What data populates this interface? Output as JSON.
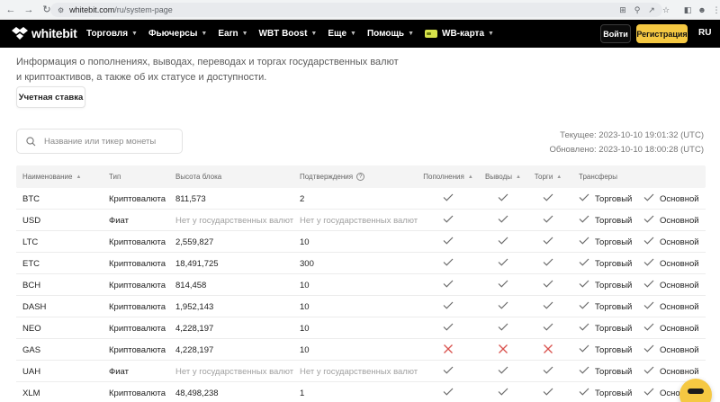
{
  "browser": {
    "url_host": "whitebit.com",
    "url_path": "/ru/system-page"
  },
  "header": {
    "logo_text": "whitebit",
    "nav": [
      {
        "label": "Торговля"
      },
      {
        "label": "Фьючерсы"
      },
      {
        "label": "Earn"
      },
      {
        "label": "WBT Boost"
      },
      {
        "label": "Еще"
      },
      {
        "label": "Помощь"
      },
      {
        "label": "WB-карта"
      }
    ],
    "login_label": "Войти",
    "register_label": "Регистрация",
    "lang_label": "RU"
  },
  "intro": {
    "text_line1": "Информация о пополнениях, выводах, переводах и торгах государственных валют",
    "text_line2": "и криптоактивов, а также об их статусе и доступности.",
    "rate_button": "Учетная ставка"
  },
  "search": {
    "placeholder": "Название или тикер монеты"
  },
  "times": {
    "current": "Текущее: 2023-10-10 19:01:32 (UTC)",
    "updated": "Обновлено: 2023-10-10 18:00:28 (UTC)"
  },
  "table": {
    "headers": {
      "name": "Наименование",
      "type": "Тип",
      "height": "Высота блока",
      "confirmations": "Подтверждения",
      "deposits": "Пополнения",
      "withdrawals": "Выводы",
      "trading": "Торги",
      "transfers": "Трансферы"
    },
    "rows": [
      {
        "name": "BTC",
        "type": "Криптовалюта",
        "height": "811,573",
        "conf": "2",
        "dep": "ok",
        "wd": "ok",
        "tr": "ok",
        "tf1": "Торговый",
        "tf2": "Основной"
      },
      {
        "name": "USD",
        "type": "Фиат",
        "height": "Нет у государственных валют",
        "conf": "Нет у государственных валют",
        "dep": "ok",
        "wd": "ok",
        "tr": "ok",
        "tf1": "Торговый",
        "tf2": "Основной"
      },
      {
        "name": "LTC",
        "type": "Криптовалюта",
        "height": "2,559,827",
        "conf": "10",
        "dep": "ok",
        "wd": "ok",
        "tr": "ok",
        "tf1": "Торговый",
        "tf2": "Основной"
      },
      {
        "name": "ETC",
        "type": "Криптовалюта",
        "height": "18,491,725",
        "conf": "300",
        "dep": "ok",
        "wd": "ok",
        "tr": "ok",
        "tf1": "Торговый",
        "tf2": "Основной"
      },
      {
        "name": "BCH",
        "type": "Криптовалюта",
        "height": "814,458",
        "conf": "10",
        "dep": "ok",
        "wd": "ok",
        "tr": "ok",
        "tf1": "Торговый",
        "tf2": "Основной"
      },
      {
        "name": "DASH",
        "type": "Криптовалюта",
        "height": "1,952,143",
        "conf": "10",
        "dep": "ok",
        "wd": "ok",
        "tr": "ok",
        "tf1": "Торговый",
        "tf2": "Основной"
      },
      {
        "name": "NEO",
        "type": "Криптовалюта",
        "height": "4,228,197",
        "conf": "10",
        "dep": "ok",
        "wd": "ok",
        "tr": "ok",
        "tf1": "Торговый",
        "tf2": "Основной"
      },
      {
        "name": "GAS",
        "type": "Криптовалюта",
        "height": "4,228,197",
        "conf": "10",
        "dep": "no",
        "wd": "no",
        "tr": "no",
        "tf1": "Торговый",
        "tf2": "Основной"
      },
      {
        "name": "UAH",
        "type": "Фиат",
        "height": "Нет у государственных валют",
        "conf": "Нет у государственных валют",
        "dep": "ok",
        "wd": "ok",
        "tr": "ok",
        "tf1": "Торговый",
        "tf2": "Основной"
      },
      {
        "name": "XLM",
        "type": "Криптовалюта",
        "height": "48,498,238",
        "conf": "1",
        "dep": "ok",
        "wd": "ok",
        "tr": "ok",
        "tf1": "Торговый",
        "tf2": "Основной"
      }
    ]
  },
  "colors": {
    "brand_yellow": "#f5c842",
    "header_bg": "#000000",
    "check": "#6b6b6b",
    "cross": "#d9534f"
  },
  "icons": {
    "status_ok": "check-icon",
    "status_no": "cross-icon",
    "chat": "chat-icon"
  }
}
